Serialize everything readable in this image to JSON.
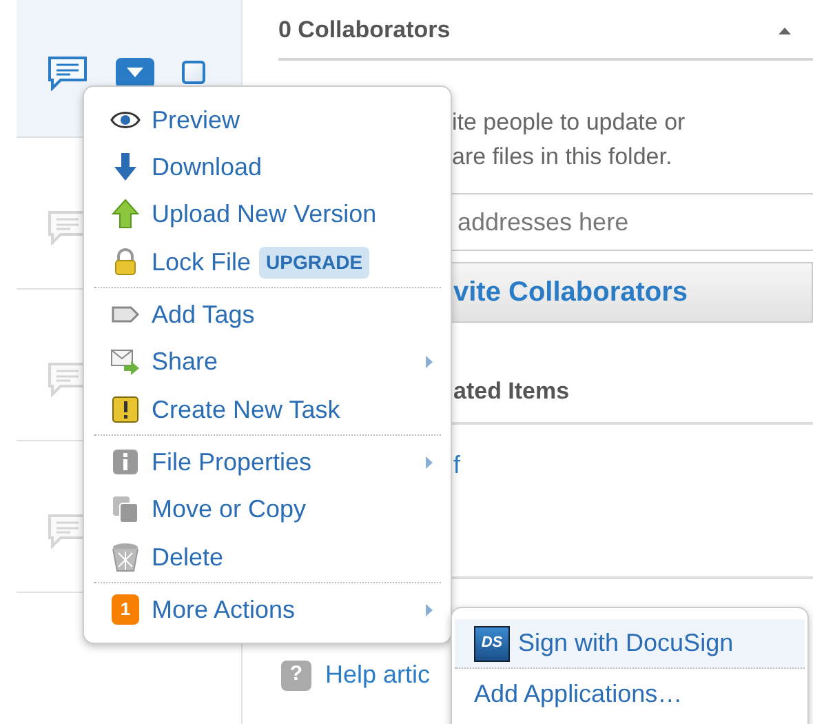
{
  "file_rows": [
    {
      "selected": true,
      "comment_active": true
    },
    {
      "selected": false,
      "comment_active": false
    },
    {
      "selected": false,
      "comment_active": false
    },
    {
      "selected": false,
      "comment_active": false
    }
  ],
  "panel": {
    "header": "0 Collaborators",
    "intro_lines": [
      "ite people to update or",
      "are files in this folder."
    ],
    "email_field": {
      "placeholder": "addresses here"
    },
    "invite_button": "vite Collaborators",
    "related_header": "ated Items",
    "related_link": "f",
    "help_icon": "?",
    "help_link": "Help artic"
  },
  "context_menu": {
    "items": [
      {
        "label": "Preview",
        "kind": "eye",
        "submenu": false,
        "separator_after": false
      },
      {
        "label": "Download",
        "kind": "download",
        "submenu": false,
        "separator_after": false
      },
      {
        "label": "Upload New Version",
        "kind": "upload",
        "submenu": false,
        "separator_after": false
      },
      {
        "label": "Lock File",
        "kind": "lock",
        "badge": "UPGRADE",
        "submenu": false,
        "separator_after": true
      },
      {
        "label": "Add Tags",
        "kind": "tag",
        "submenu": false,
        "separator_after": false
      },
      {
        "label": "Share",
        "kind": "share",
        "submenu": true,
        "separator_after": false
      },
      {
        "label": "Create New Task",
        "kind": "task",
        "submenu": false,
        "separator_after": true
      },
      {
        "label": "File Properties",
        "kind": "info",
        "submenu": true,
        "separator_after": false
      },
      {
        "label": "Move or Copy",
        "kind": "copy",
        "submenu": false,
        "separator_after": false
      },
      {
        "label": "Delete",
        "kind": "delete",
        "submenu": false,
        "separator_after": true
      },
      {
        "label": "More Actions",
        "kind": "more",
        "count": "1",
        "submenu": true,
        "separator_after": false
      }
    ]
  },
  "submenu": {
    "items": [
      {
        "label": "Sign with DocuSign",
        "kind": "app",
        "logo_text": "DS",
        "selected": true,
        "separator_after": true
      },
      {
        "label": "Add Applications…",
        "kind": "link",
        "selected": false,
        "separator_after": false
      }
    ]
  }
}
